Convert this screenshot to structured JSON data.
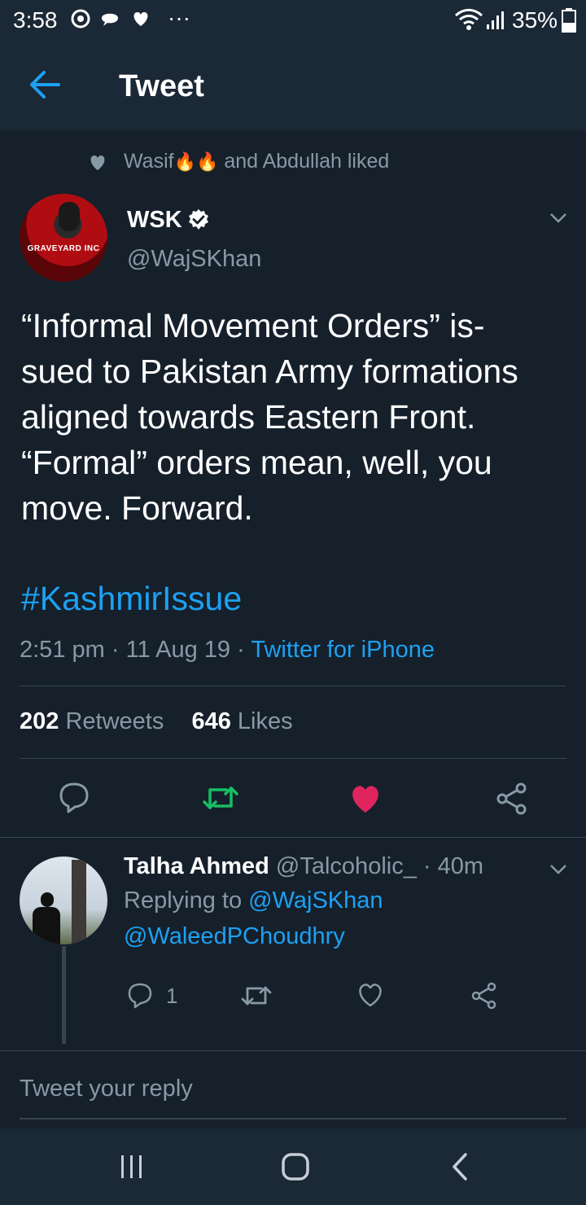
{
  "status_bar": {
    "time": "3:58",
    "battery_pct": "35%",
    "icons": [
      "vpn-icon",
      "chat-icon",
      "heart-icon",
      "more-icon",
      "wifi-icon",
      "signal-icon",
      "battery-icon"
    ]
  },
  "header": {
    "title": "Tweet"
  },
  "social_context": {
    "prefix": "Wasif",
    "suffix": "and Abdullah liked"
  },
  "tweet": {
    "author_name": "WSK",
    "author_handle": "@WajSKhan",
    "avatar_text": "GRAVEYARD INC",
    "text_lines": [
      "“Informal Movement Orders” is-",
      "sued to Pakistan Army formations",
      "aligned towards Eastern Front.",
      "“Formal” orders mean, well, you",
      "move. Forward."
    ],
    "hashtag": "#KashmirIssue",
    "time": "2:51 pm",
    "date": "11 Aug 19",
    "source": "Twitter for iPhone",
    "retweets_count": "202",
    "retweets_label": "Retweets",
    "likes_count": "646",
    "likes_label": "Likes"
  },
  "reply": {
    "author_name": "Talha Ahmed",
    "author_handle": "@Talcoholic_",
    "age": "· 40m",
    "replying_to_label": "Replying to",
    "replying_to_1": "@WajSKhan",
    "replying_to_2": "@WaleedPChoudhry",
    "reply_count": "1"
  },
  "compose": {
    "placeholder": "Tweet your reply"
  },
  "colors": {
    "background": "#15202b",
    "header": "#1b2836",
    "accent": "#1da1f2",
    "like": "#e0245e",
    "retweet": "#17bf63",
    "muted": "#8899a6"
  }
}
